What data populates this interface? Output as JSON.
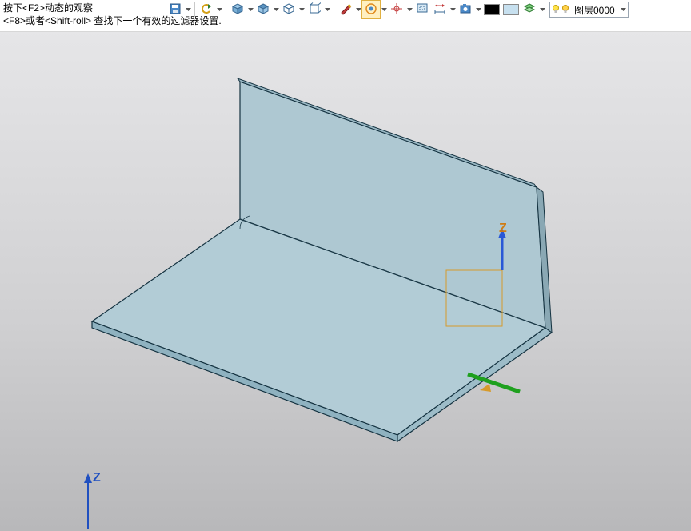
{
  "hint": {
    "line1": "按下<F2>动态的观察",
    "line2": "<F8>或者<Shift-roll> 查找下一个有效的过滤器设置."
  },
  "toolbar": {
    "icons": [
      "save",
      "undo",
      "cube-iso",
      "cube-top",
      "cube-wire",
      "cube-outline",
      "brush",
      "orbit-highlighted",
      "target",
      "window-zoom",
      "measure",
      "screenshot",
      "black-swatch",
      "lightblue-swatch",
      "layers"
    ]
  },
  "colors": {
    "black_swatch": "#000000",
    "light_swatch": "#c7e0ef",
    "accent_orange": "#e08a1e"
  },
  "layer": {
    "name": "图层0000"
  },
  "axes": {
    "main": "Z",
    "gizmo": "Z"
  }
}
